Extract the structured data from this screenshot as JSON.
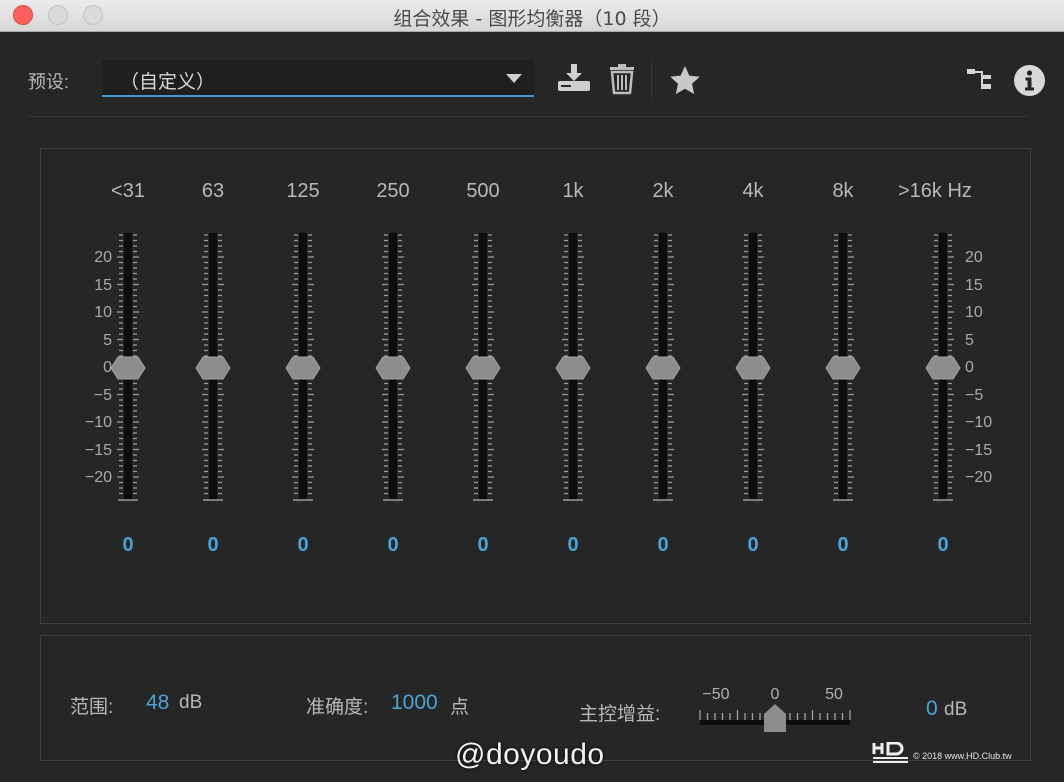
{
  "window": {
    "title": "组合效果 - 图形均衡器（10 段）"
  },
  "toolbar": {
    "preset_label": "预设:",
    "preset_value": "（自定义）",
    "icons": [
      "save-preset-icon",
      "delete-preset-icon",
      "favorite-star-icon",
      "routing-icon",
      "info-icon"
    ]
  },
  "eq": {
    "bands": [
      {
        "label": "<31",
        "value": "0",
        "gain_db": 0
      },
      {
        "label": "63",
        "value": "0",
        "gain_db": 0
      },
      {
        "label": "125",
        "value": "0",
        "gain_db": 0
      },
      {
        "label": "250",
        "value": "0",
        "gain_db": 0
      },
      {
        "label": "500",
        "value": "0",
        "gain_db": 0
      },
      {
        "label": "1k",
        "value": "0",
        "gain_db": 0
      },
      {
        "label": "2k",
        "value": "0",
        "gain_db": 0
      },
      {
        "label": "4k",
        "value": "0",
        "gain_db": 0
      },
      {
        "label": "8k",
        "value": "0",
        "gain_db": 0
      },
      {
        "label": ">16k Hz",
        "value": "0",
        "gain_db": 0
      }
    ],
    "scale": [
      "20",
      "15",
      "10",
      "5",
      "0",
      "−5",
      "−10",
      "−15",
      "−20"
    ],
    "scale_values": [
      20,
      15,
      10,
      5,
      0,
      -5,
      -10,
      -15,
      -20
    ]
  },
  "bottom": {
    "range_label": "范围:",
    "range_value": "48",
    "range_unit": "dB",
    "accuracy_label": "准确度:",
    "accuracy_value": "1000",
    "accuracy_unit": "点",
    "master_gain_label": "主控增益:",
    "master_gain_ticks": [
      "−50",
      "0",
      "50"
    ],
    "master_gain_value": "0",
    "master_gain_unit": "dB",
    "master_gain_db": 0,
    "master_gain_min": -50,
    "master_gain_max": 50
  },
  "overlay": {
    "watermark": "@doyoudo",
    "logo": "HD CLUB",
    "copyright": "© 2018 www.HD.Club.tw"
  },
  "colors": {
    "accent": "#4aa3d8",
    "background": "#262626",
    "close_button": "#fc605c"
  }
}
